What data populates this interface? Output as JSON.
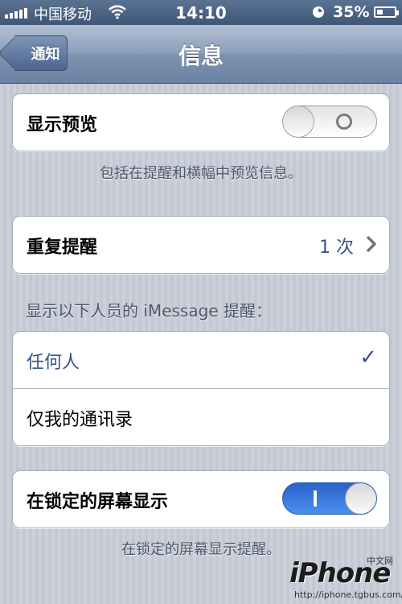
{
  "status_bar": {
    "carrier": "中国移动",
    "time": "14:10",
    "battery_percent": "35%",
    "battery_level": 0.35,
    "icons": [
      "signal-bars-icon",
      "wifi-icon",
      "alarm-icon",
      "battery-icon"
    ]
  },
  "nav": {
    "back_label": "通知",
    "title": "信息"
  },
  "preview": {
    "label": "显示预览",
    "switch_on": false,
    "footer": "包括在提醒和横幅中预览信息。"
  },
  "repeat": {
    "label": "重复提醒",
    "value": "1 次",
    "icon": "chevron-right-icon"
  },
  "imessage": {
    "header": "显示以下人员的 iMessage 提醒：",
    "options": [
      {
        "label": "任何人",
        "selected": true
      },
      {
        "label": "仅我的通讯录",
        "selected": false
      }
    ]
  },
  "lock_screen": {
    "label": "在锁定的屏幕显示",
    "switch_on": true,
    "footer": "在锁定的屏幕显示提醒。"
  },
  "watermark": {
    "brand": "iPhone",
    "cn_label": "中文网",
    "url": "http://iphone.tgbus.com/"
  },
  "colors": {
    "accent_blue": "#385487",
    "switch_on_blue": "#2f6fd8",
    "nav_bar": "#7e92b0"
  }
}
